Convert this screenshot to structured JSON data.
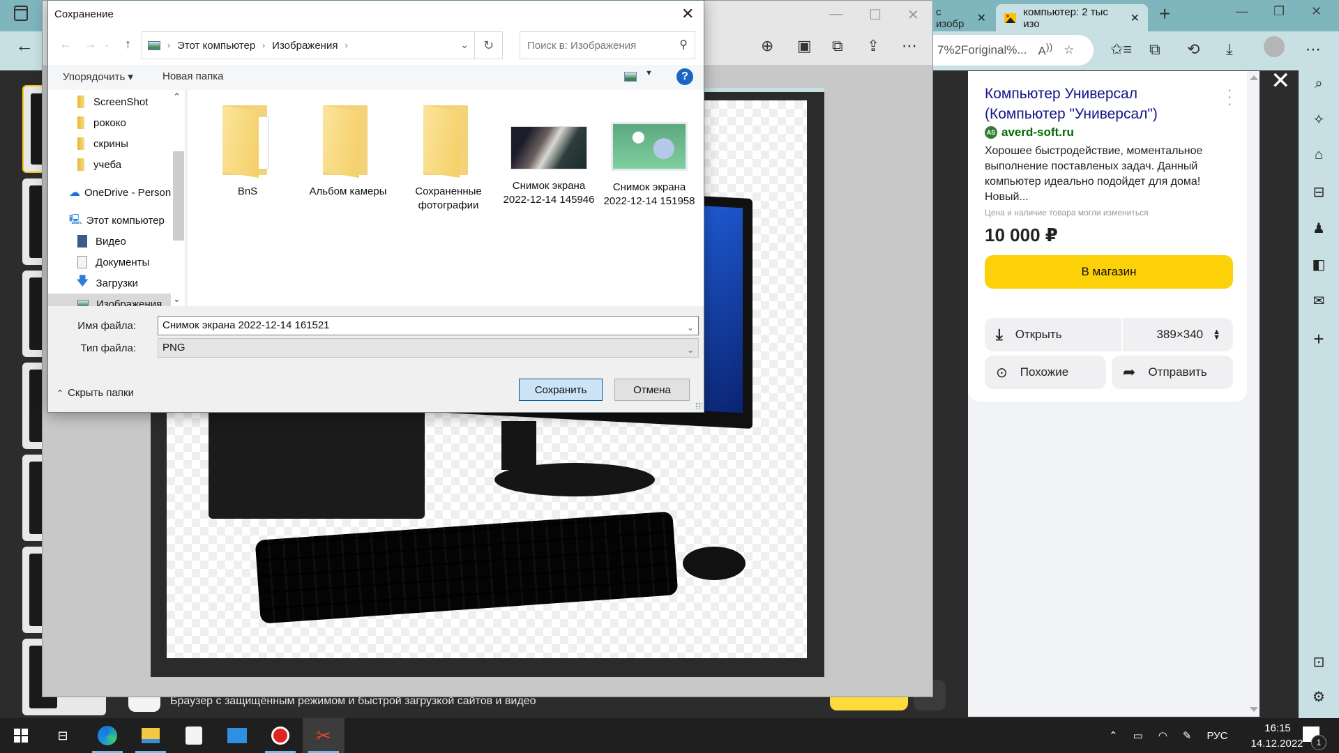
{
  "browser": {
    "tabs": [
      {
        "label": "с изобр",
        "active": false
      },
      {
        "label": "компьютер: 2 тыс изо",
        "active": true
      }
    ],
    "new_tab": "+",
    "window_controls": {
      "minimize": "—",
      "maximize": "❐",
      "close": "✕"
    },
    "url_text": "7%2Foriginal%...",
    "toolbar_icons": [
      "read-aloud-icon",
      "add-favorite-icon",
      "favorites-icon",
      "collections-icon",
      "history-icon",
      "downloads-icon",
      "profile-icon",
      "more-icon"
    ]
  },
  "viewer": {
    "window_controls": {
      "minimize": "—",
      "maximize": "☐",
      "close": "✕"
    },
    "tools": [
      "zoom-in-icon",
      "save-icon",
      "copy-icon",
      "share-icon",
      "more-icon"
    ]
  },
  "dialog": {
    "title": "Сохранение",
    "breadcrumb": [
      "Этот компьютер",
      "Изображения"
    ],
    "search_placeholder": "Поиск в: Изображения",
    "organize_label": "Упорядочить ▾",
    "new_folder_label": "Новая папка",
    "nav_items": [
      {
        "label": "ScreenShot",
        "icon": "folder"
      },
      {
        "label": "рококо",
        "icon": "folder"
      },
      {
        "label": "скрины",
        "icon": "folder"
      },
      {
        "label": "учеба",
        "icon": "folder"
      },
      {
        "label": "OneDrive - Person",
        "icon": "onedrive"
      },
      {
        "label": "Этот компьютер",
        "icon": "computer"
      },
      {
        "label": "Видео",
        "icon": "video"
      },
      {
        "label": "Документы",
        "icon": "documents"
      },
      {
        "label": "Загрузки",
        "icon": "downloads"
      },
      {
        "label": "Изображения",
        "icon": "pictures",
        "selected": true
      }
    ],
    "files": [
      {
        "name": "BnS",
        "type": "folder-with-docs"
      },
      {
        "name": "Альбом камеры",
        "type": "folder"
      },
      {
        "name": "Сохраненные фотографии",
        "type": "folder"
      },
      {
        "name": "Снимок экрана 2022-12-14 145946",
        "type": "image"
      },
      {
        "name": "Снимок экрана 2022-12-14 151958",
        "type": "image"
      }
    ],
    "filename_label": "Имя файла:",
    "filename_value": "Снимок экрана 2022-12-14 161521",
    "filetype_label": "Тип файла:",
    "filetype_value": "PNG",
    "hide_folders_label": "Скрыть папки",
    "save_label": "Сохранить",
    "cancel_label": "Отмена"
  },
  "banner": {
    "text": "Браузер с защищённым режимом и быстрой загрузкой сайтов и видео"
  },
  "ad": {
    "title": "Компьютер Универсал (Компьютер \"Универсал\")",
    "site": "averd-soft.ru",
    "site_logo": "AS",
    "description": "Хорошее быстродействие, моментальное выполнение поставленых задач. Данный компьютер идеально подойдет для дома! Новый...",
    "note": "Цена и наличие товара могли измениться",
    "price": "10 000 ₽",
    "shop_label": "В магазин",
    "open_label": "Открыть",
    "size_label": "389×340",
    "similar_label": "Похожие",
    "share_label": "Отправить"
  },
  "sidebar_icons": [
    "search-icon",
    "sparkle-icon",
    "tag-icon",
    "toolbox-icon",
    "games-icon",
    "office-icon",
    "outlook-icon",
    "add-icon",
    "split-screen-icon",
    "settings-icon"
  ],
  "taskbar": {
    "apps": [
      "start",
      "task-view",
      "edge",
      "file-explorer",
      "store",
      "mail",
      "recorder",
      "snipping-tool"
    ],
    "language": "РУС",
    "time": "16:15",
    "date": "14.12.2022",
    "notifications": "1"
  },
  "colors": {
    "accent_blue": "#1a66c2",
    "yandex_yellow": "#fdd107",
    "ad_title": "#13138a",
    "ad_site": "#006800"
  }
}
